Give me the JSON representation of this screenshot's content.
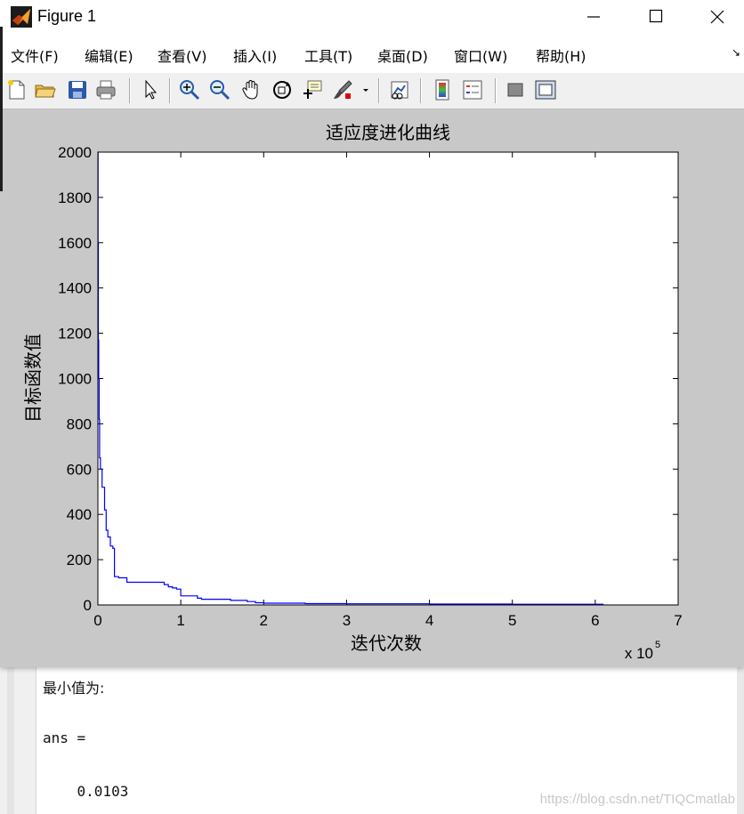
{
  "window": {
    "title": "Figure 1",
    "controls": {
      "minimize": "—",
      "maximize": "☐",
      "close": "✕"
    }
  },
  "menu": {
    "items": [
      "文件(F)",
      "编辑(E)",
      "查看(V)",
      "插入(I)",
      "工具(T)",
      "桌面(D)",
      "窗口(W)",
      "帮助(H)"
    ],
    "overflow": "↘"
  },
  "toolbar": {
    "buttons": [
      "new-figure",
      "open-file",
      "save",
      "print",
      "edit-plot-pointer",
      "zoom-in",
      "zoom-out",
      "pan-hand",
      "rotate-3d",
      "data-cursor",
      "brush",
      "brush-dropdown",
      "link-plot",
      "colorbar",
      "legend",
      "hide-plot-tools",
      "show-plot-tools"
    ]
  },
  "chart_data": {
    "type": "line",
    "title": "适应度进化曲线",
    "xlabel": "迭代次数",
    "ylabel": "目标函数值",
    "x_multiplier": "x 10",
    "x_multiplier_exp": "5",
    "xlim": [
      0,
      7
    ],
    "ylim": [
      0,
      2000
    ],
    "xticks": [
      "0",
      "1",
      "2",
      "3",
      "4",
      "5",
      "6",
      "7"
    ],
    "yticks": [
      "0",
      "200",
      "400",
      "600",
      "800",
      "1000",
      "1200",
      "1400",
      "1600",
      "1800",
      "2000"
    ],
    "grid": false,
    "series": [
      {
        "color": "#0000ff",
        "x": [
          0,
          0.002,
          0.005,
          0.01,
          0.015,
          0.02,
          0.03,
          0.05,
          0.08,
          0.1,
          0.12,
          0.15,
          0.18,
          0.2,
          0.25,
          0.35,
          0.5,
          0.65,
          0.8,
          0.85,
          0.9,
          0.95,
          1.0,
          1.1,
          1.2,
          1.25,
          1.4,
          1.6,
          1.8,
          1.9,
          2.0,
          2.5,
          3.0,
          4.0,
          5.0,
          6.0,
          6.1
        ],
        "y": [
          2000,
          1600,
          1170,
          1000,
          820,
          650,
          600,
          520,
          420,
          330,
          300,
          260,
          250,
          125,
          120,
          100,
          100,
          100,
          90,
          80,
          75,
          70,
          40,
          40,
          30,
          25,
          25,
          20,
          15,
          10,
          8,
          6,
          5,
          4,
          3,
          3,
          3
        ]
      }
    ]
  },
  "console": {
    "line1": "最小值为:",
    "line2": "ans =",
    "line3": "    0.0103",
    "watermark": "https://blog.csdn.net/TIQCmatlab"
  },
  "colors": {
    "figure_bg": "#c8c8c8",
    "axes_bg": "#ffffff",
    "series": "#0000ff",
    "titlebar_bg": "#ffffff",
    "toolbar_bg": "#f0f0f0"
  }
}
